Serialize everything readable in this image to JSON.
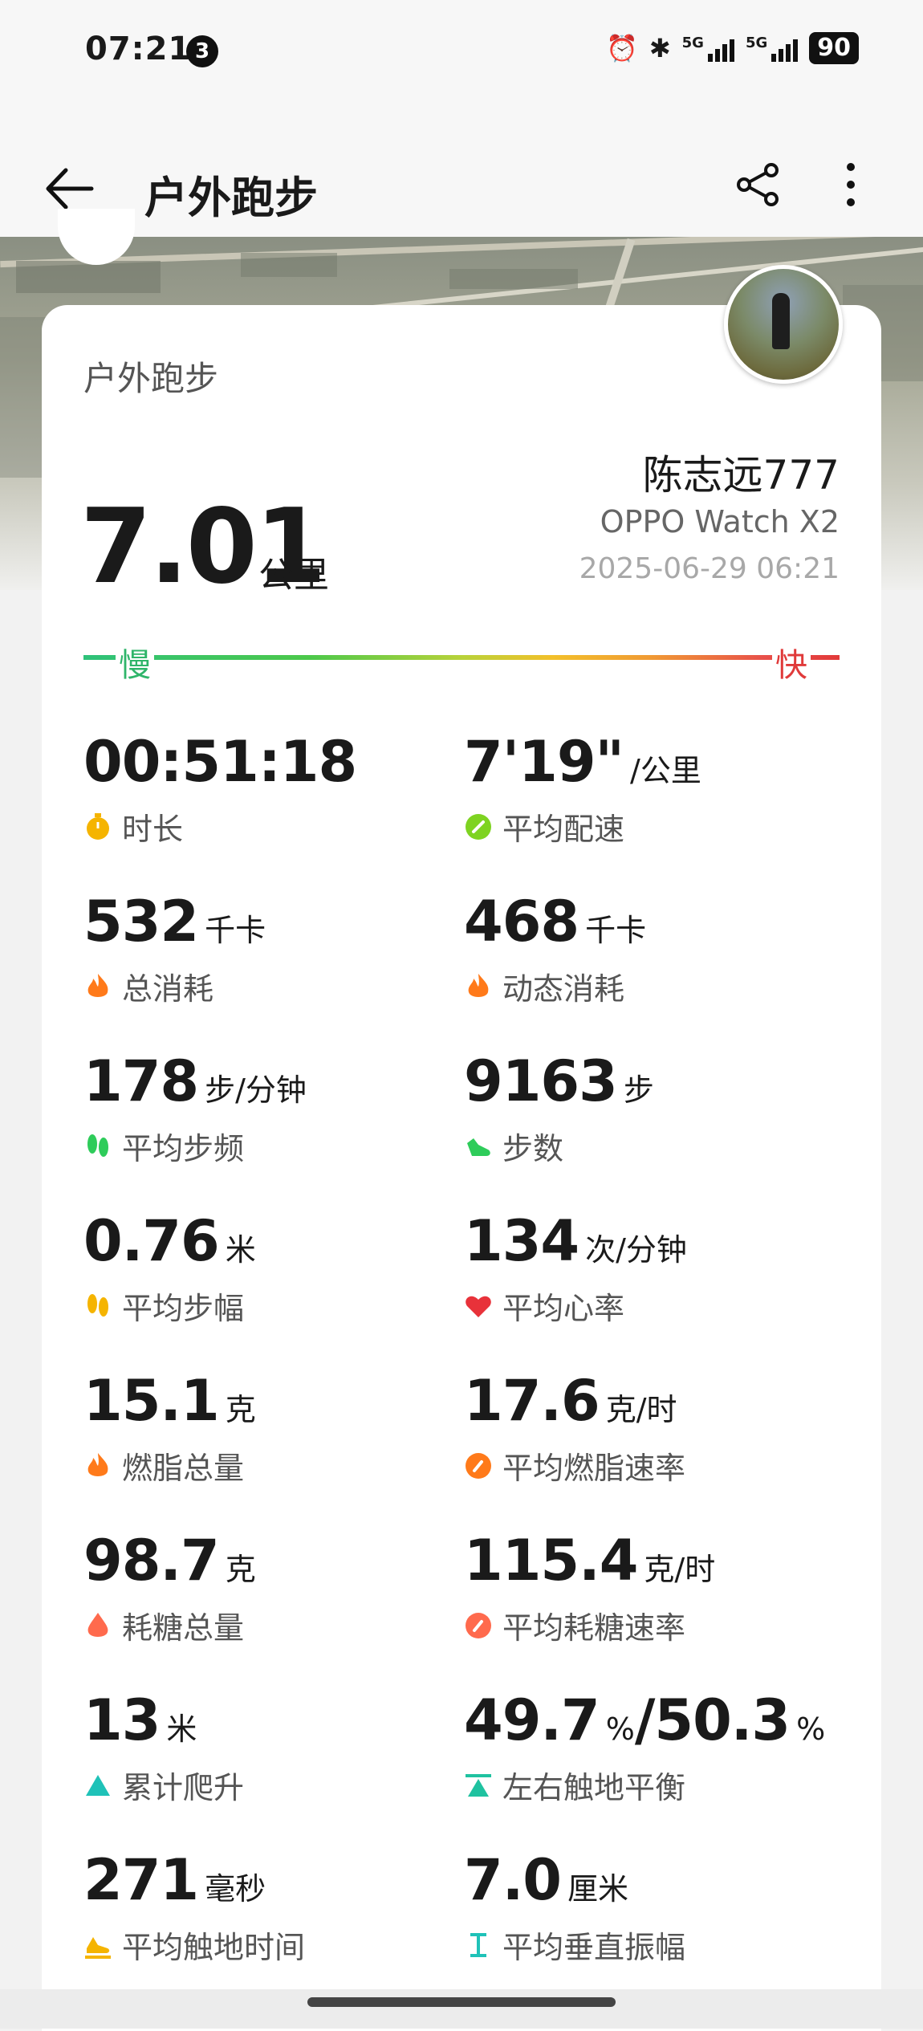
{
  "status_bar": {
    "time": "07:21",
    "notification_count": "3",
    "icons": [
      "alarm-icon",
      "bluetooth-icon",
      "signal-5g-icon",
      "signal-5g-icon"
    ],
    "signal_label_1": "5G",
    "signal_label_2": "5G",
    "battery": "90"
  },
  "app_bar": {
    "title": "户外跑步",
    "back_icon": "back-arrow-icon",
    "share_icon": "share-icon",
    "more_icon": "more-vertical-icon"
  },
  "summary": {
    "activity_type": "户外跑步",
    "distance_value": "7.01",
    "distance_unit": "公里",
    "user_name": "陈志远777",
    "device": "OPPO Watch X2",
    "datetime": "2025-06-29 06:21",
    "pace_scale_slow": "慢",
    "pace_scale_fast": "快"
  },
  "metrics": [
    {
      "value": "00:51:18",
      "unit": "",
      "label": "时长",
      "icon": "stopwatch-icon",
      "color": "#f5b400"
    },
    {
      "value": "7'19\"",
      "unit": "/公里",
      "label": "平均配速",
      "icon": "pace-gauge-icon",
      "color": "#7ed321"
    },
    {
      "value": "532",
      "unit": "千卡",
      "label": "总消耗",
      "icon": "flame-icon",
      "color": "#ff7a1a"
    },
    {
      "value": "468",
      "unit": "千卡",
      "label": "动态消耗",
      "icon": "flame-icon",
      "color": "#ff7a1a"
    },
    {
      "value": "178",
      "unit": "步/分钟",
      "label": "平均步频",
      "icon": "footprints-icon",
      "color": "#2ecc5a"
    },
    {
      "value": "9163",
      "unit": "步",
      "label": "步数",
      "icon": "shoe-icon",
      "color": "#2ecc5a"
    },
    {
      "value": "0.76",
      "unit": "米",
      "label": "平均步幅",
      "icon": "footprints-icon",
      "color": "#f5b400"
    },
    {
      "value": "134",
      "unit": "次/分钟",
      "label": "平均心率",
      "icon": "heart-icon",
      "color": "#e8323a"
    },
    {
      "value": "15.1",
      "unit": "克",
      "label": "燃脂总量",
      "icon": "flame-icon",
      "color": "#ff7a1a"
    },
    {
      "value": "17.6",
      "unit": "克/时",
      "label": "平均燃脂速率",
      "icon": "gauge-icon",
      "color": "#ff7a1a"
    },
    {
      "value": "98.7",
      "unit": "克",
      "label": "耗糖总量",
      "icon": "drop-icon",
      "color": "#ff6a4d"
    },
    {
      "value": "115.4",
      "unit": "克/时",
      "label": "平均耗糖速率",
      "icon": "gauge-icon",
      "color": "#ff6a4d"
    },
    {
      "value": "13",
      "unit": "米",
      "label": "累计爬升",
      "icon": "triangle-up-icon",
      "color": "#1fc2b8"
    },
    {
      "value": "49.7",
      "unit": "%",
      "value2": "/50.3",
      "unit2": "%",
      "label": "左右触地平衡",
      "icon": "balance-icon",
      "color": "#1fc2a0"
    },
    {
      "value": "271",
      "unit": "毫秒",
      "label": "平均触地时间",
      "icon": "shoe-ground-icon",
      "color": "#f5b400"
    },
    {
      "value": "7.0",
      "unit": "厘米",
      "label": "平均垂直振幅",
      "icon": "vertical-oscillation-icon",
      "color": "#1fc2b8"
    }
  ]
}
